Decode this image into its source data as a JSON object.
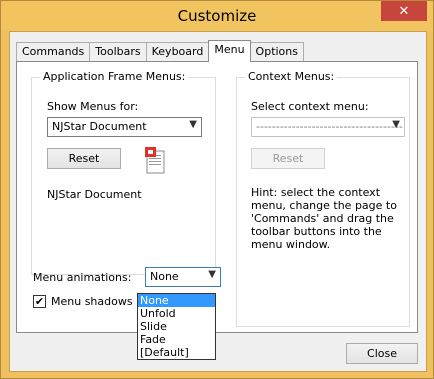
{
  "window": {
    "title": "Customize",
    "close_glyph": "✕"
  },
  "tabs": [
    {
      "label": "Commands"
    },
    {
      "label": "Toolbars"
    },
    {
      "label": "Keyboard"
    },
    {
      "label": "Menu",
      "active": true
    },
    {
      "label": "Options"
    }
  ],
  "app_frame": {
    "legend": "Application Frame Menus:",
    "show_for_label": "Show Menus for:",
    "show_for_value": "NJStar Document",
    "reset_label": "Reset",
    "document_name": "NJStar Document",
    "icon": "document-icon"
  },
  "context": {
    "legend": "Context Menus:",
    "select_label": "Select context menu:",
    "select_value": "-------------------------------------------",
    "reset_label": "Reset",
    "hint": "Hint: select the context menu, change the page to 'Commands' and drag the toolbar buttons into the menu window."
  },
  "animations": {
    "label": "Menu animations:",
    "value": "None",
    "options": [
      "None",
      "Unfold",
      "Slide",
      "Fade",
      "[Default]"
    ],
    "selected_index": 0
  },
  "shadows": {
    "label": "Menu shadows",
    "checked": true,
    "check_glyph": "✔"
  },
  "footer": {
    "close_label": "Close"
  },
  "colors": {
    "title_bar": "#f2c45f",
    "close_button": "#c7463b",
    "selection": "#3399ff"
  }
}
